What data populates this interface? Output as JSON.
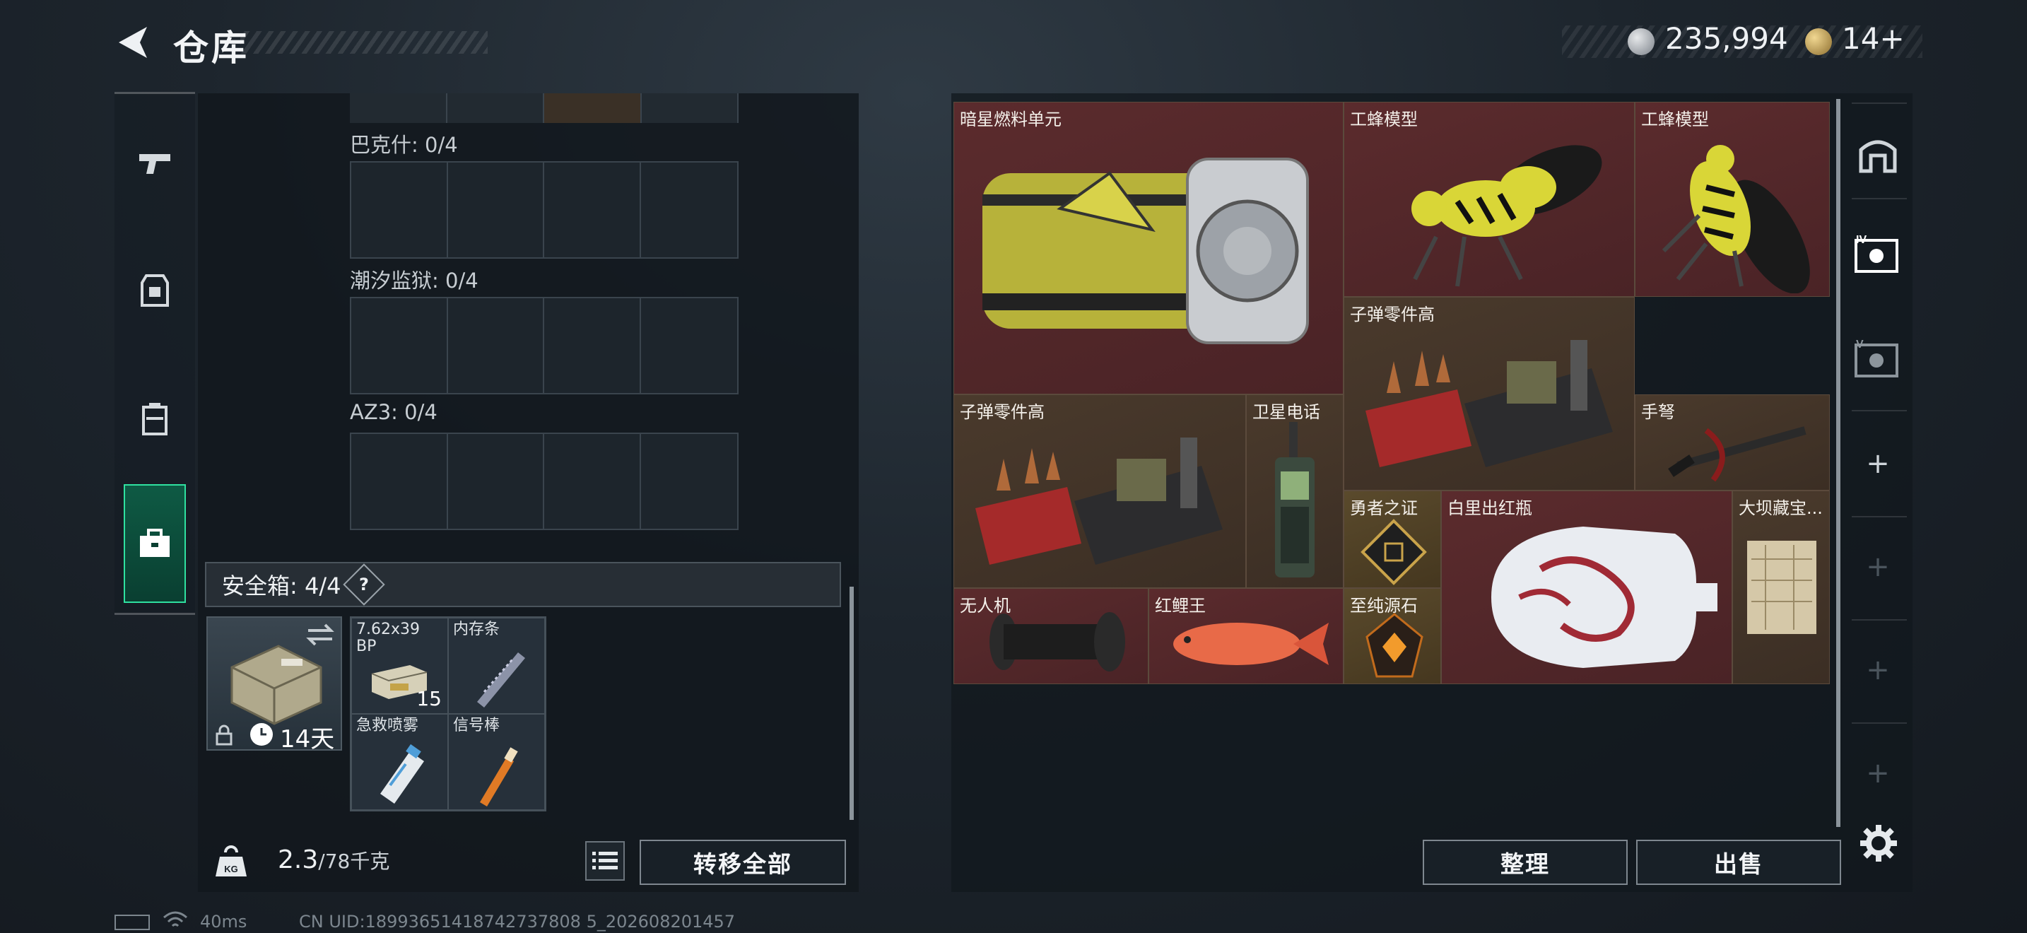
{
  "header": {
    "title": "仓库",
    "currency_silver": "235,994",
    "currency_gold": "14+"
  },
  "left_panel": {
    "collection_groups": [
      {
        "label": "巴克什: 0/4"
      },
      {
        "label": "潮汐监狱: 0/4"
      },
      {
        "label": "AZ3: 0/4"
      }
    ],
    "safe_box": {
      "header": "安全箱: 4/4",
      "help": "?",
      "duration": "14天",
      "items": [
        {
          "label": "7.62x39 BP",
          "qty": "15"
        },
        {
          "label": "内存条",
          "qty": ""
        },
        {
          "label": "急救喷雾",
          "qty": ""
        },
        {
          "label": "信号棒",
          "qty": ""
        }
      ]
    },
    "weight_current": "2.3",
    "weight_max": "/78千克",
    "weight_icon_text": "KG",
    "transfer_all": "转移全部"
  },
  "right_panel": {
    "items": [
      {
        "label": "暗星燃料单元"
      },
      {
        "label": "工蜂模型"
      },
      {
        "label": "工蜂模型"
      },
      {
        "label": "子弹零件高"
      },
      {
        "label": "子弹零件高"
      },
      {
        "label": "卫星电话"
      },
      {
        "label": "手弩"
      },
      {
        "label": "勇者之证"
      },
      {
        "label": "白里出红瓶"
      },
      {
        "label": "大坝藏宝..."
      },
      {
        "label": "无人机"
      },
      {
        "label": "红鲤王"
      },
      {
        "label": "至纯源石"
      }
    ],
    "sort": "整理",
    "sell": "出售"
  },
  "status_bar": {
    "ping": "40ms",
    "uid": "CN UID:18993651418742737808 5_202608201457"
  },
  "colors": {
    "accent_green": "#2fe1a0",
    "item_red": "#5b2b2d",
    "item_brown": "#4a3a2c"
  }
}
